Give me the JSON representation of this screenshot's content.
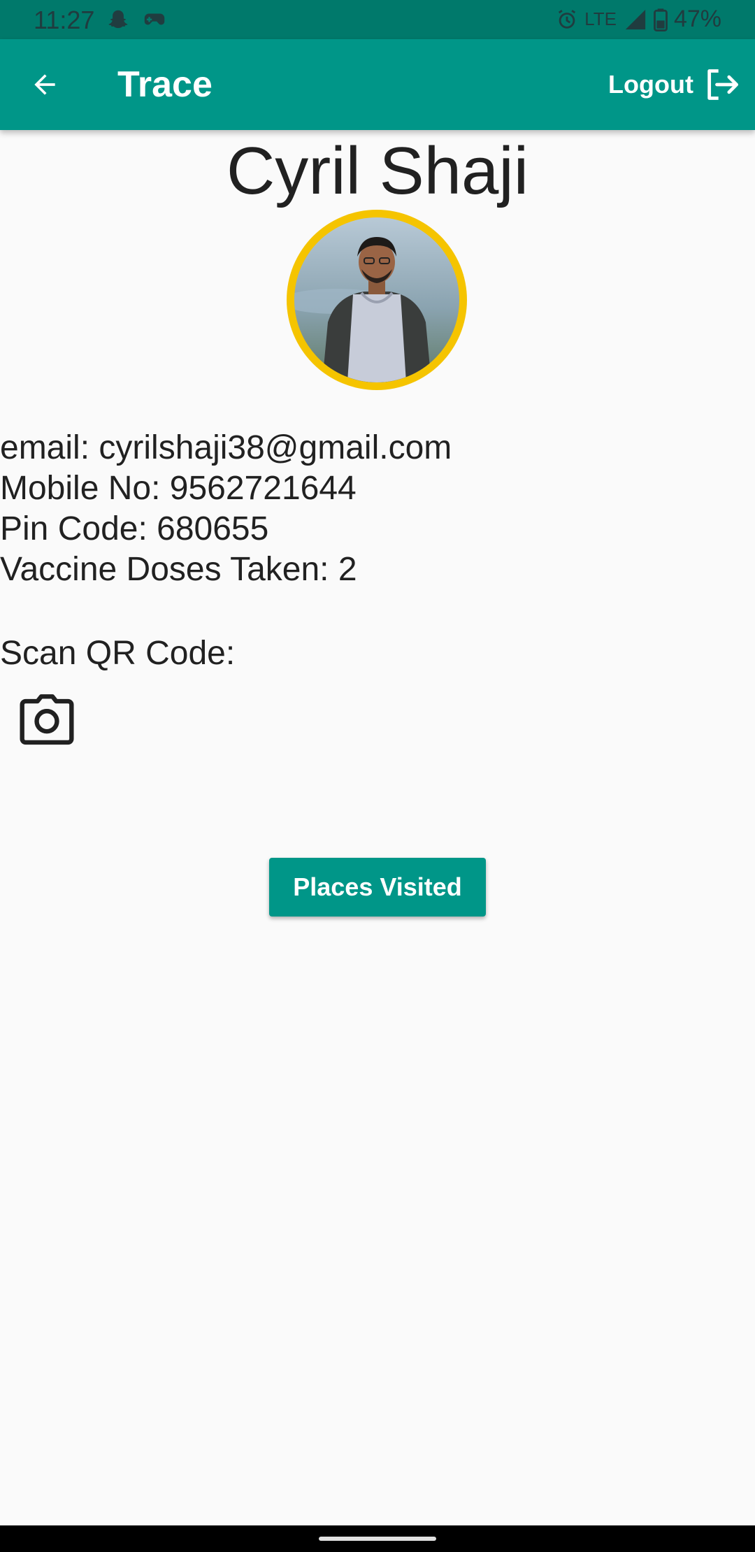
{
  "status_bar": {
    "time": "11:27",
    "network": "LTE",
    "battery": "47%",
    "left_icons": [
      "snapchat-icon",
      "game-controller-icon"
    ],
    "right_icons": [
      "alarm-icon",
      "signal-icon",
      "battery-icon"
    ]
  },
  "app_bar": {
    "title": "Trace",
    "logout_label": "Logout",
    "back_icon": "arrow-back-icon",
    "logout_icon": "logout-icon"
  },
  "profile": {
    "name": "Cyril Shaji",
    "avatar_icon": "profile-photo",
    "avatar_ring_color": "#f5c400",
    "email_line": "email: cyrilshaji38@gmail.com",
    "mobile_line": "Mobile No: 9562721644",
    "pin_line": "Pin Code: 680655",
    "vaccine_line": "Vaccine Doses Taken: 2"
  },
  "scan": {
    "label": "Scan QR Code:",
    "camera_icon": "camera-icon"
  },
  "actions": {
    "places_visited_label": "Places Visited"
  },
  "colors": {
    "primary": "#009688",
    "status_bar": "#00796b",
    "background": "#fafafa",
    "text": "#212121"
  }
}
